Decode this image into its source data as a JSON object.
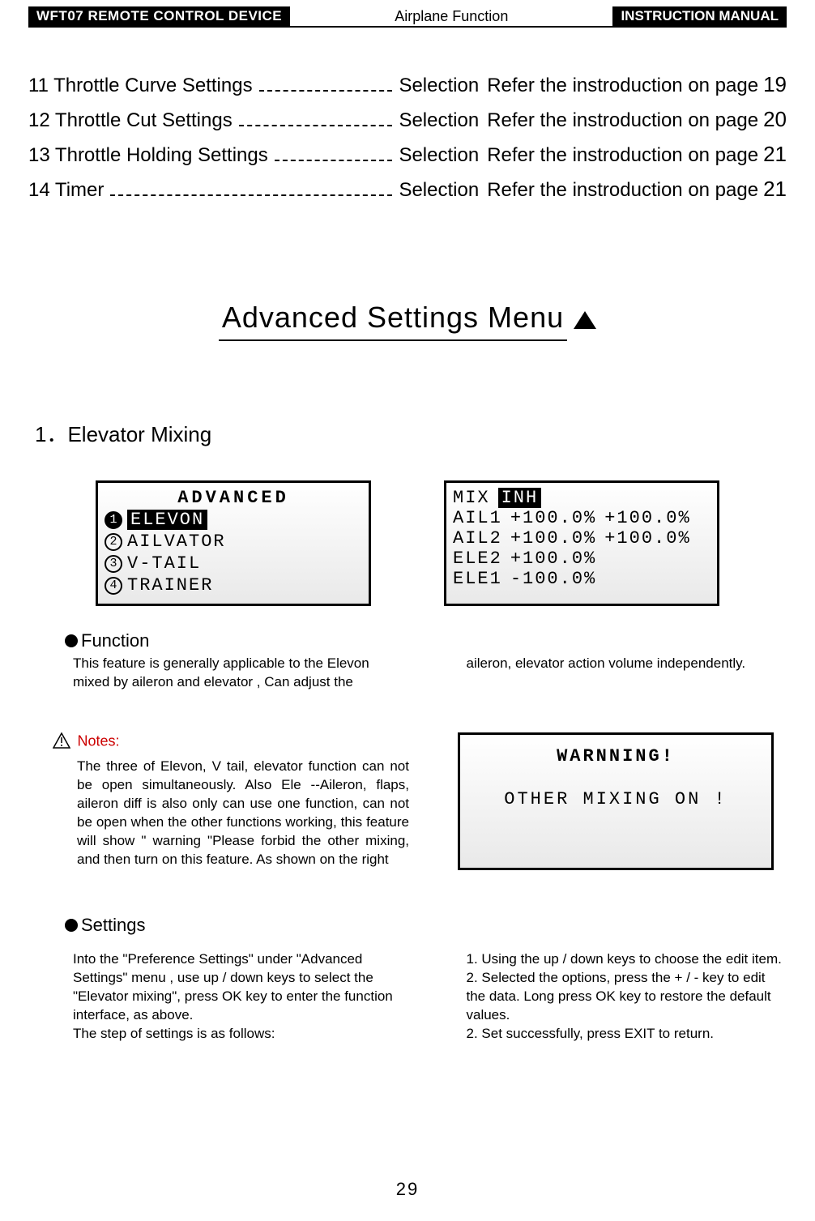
{
  "header": {
    "left": "WFT07 REMOTE CONTROL DEVICE",
    "center": "Airplane Function",
    "right": "INSTRUCTION MANUAL"
  },
  "toc": [
    {
      "title": "11 Throttle Curve Settings",
      "selection": "Selection",
      "refer": "Refer the instroduction on page",
      "page": "19"
    },
    {
      "title": "12 Throttle Cut Settings",
      "selection": "Selection",
      "refer": "Refer the instroduction on page",
      "page": "20"
    },
    {
      "title": "13 Throttle Holding Settings",
      "selection": "Selection",
      "refer": "Refer the instroduction on page",
      "page": "21"
    },
    {
      "title": "14 Timer",
      "selection": "Selection",
      "refer": "Refer the instroduction on page",
      "page": "21"
    }
  ],
  "big_heading": "Advanced Settings Menu",
  "sub_heading": "1．Elevator Mixing",
  "lcd_menu": {
    "title": "ADVANCED",
    "items": [
      {
        "num": "1",
        "label": "ELEVON",
        "selected": true
      },
      {
        "num": "2",
        "label": "AILVATOR",
        "selected": false
      },
      {
        "num": "3",
        "label": "V-TAIL",
        "selected": false
      },
      {
        "num": "4",
        "label": "TRAINER",
        "selected": false
      }
    ]
  },
  "lcd_mix": {
    "row0": {
      "label": "MIX",
      "value": "INH"
    },
    "rows": [
      {
        "label": "AIL1",
        "v1": "+100.0%",
        "v2": "+100.0%"
      },
      {
        "label": "AIL2",
        "v1": "+100.0%",
        "v2": "+100.0%"
      },
      {
        "label": "ELE2",
        "v1": "+100.0%",
        "v2": ""
      },
      {
        "label": "ELE1",
        "v1": "-100.0%",
        "v2": ""
      }
    ]
  },
  "function_label": "Function",
  "function_text_left": "This feature is generally applicable to the Elevon mixed by aileron and elevator , Can adjust the",
  "function_text_right": "aileron, elevator action volume independently.",
  "notes_label": "Notes:",
  "notes_text": "The three of Elevon, V tail, elevator function can not be open simultaneously. Also Ele --Aileron, flaps, aileron diff is also only can use one function, can not be open when the other functions working, this feature will show \" warning \"Please forbid the other mixing, and then turn on this feature. As shown on the right",
  "lcd_warn": {
    "title": "WARNNING!",
    "body": "OTHER MIXING ON !"
  },
  "settings_label": "Settings",
  "settings_left": "Into the \"Preference Settings\" under \"Advanced Settings\" menu , use up / down keys to select the \"Elevator mixing\", press OK key to enter the function interface, as above.\nThe step of settings is as follows:",
  "settings_right": "1. Using the up / down keys to choose the edit item.\n2. Selected the options, press the + / - key to edit the data. Long press OK key to restore the default values.\n2. Set successfully, press EXIT to return.",
  "page_number": "29"
}
